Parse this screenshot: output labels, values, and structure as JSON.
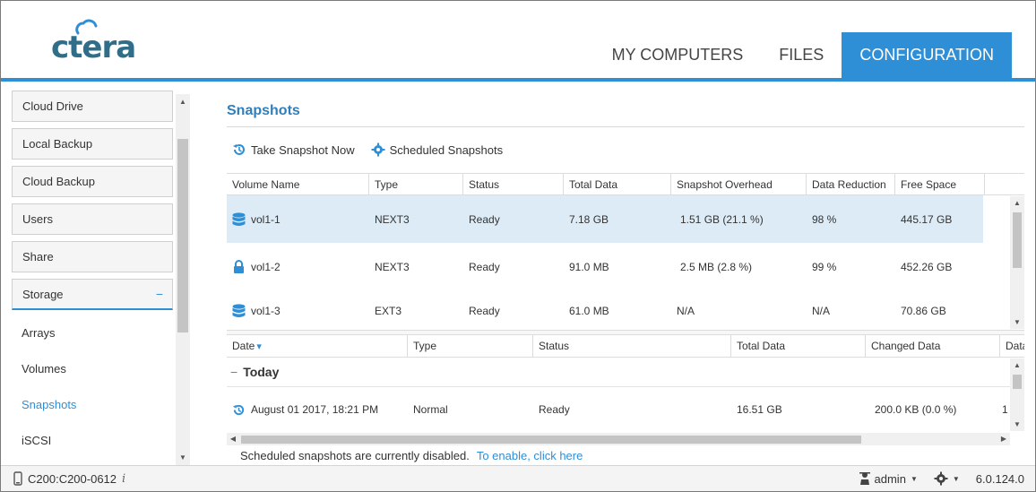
{
  "brand": {
    "logo_text": "ctera",
    "accent": "#2f8fd6",
    "title_color": "#2f7fbd",
    "selected_row": "#dcebf6"
  },
  "nav": {
    "tabs": [
      {
        "label": "MY COMPUTERS"
      },
      {
        "label": "FILES"
      },
      {
        "label": "CONFIGURATION",
        "active": true
      }
    ]
  },
  "sidebar": {
    "items": [
      {
        "label": "Cloud Drive"
      },
      {
        "label": "Local Backup"
      },
      {
        "label": "Cloud Backup"
      },
      {
        "label": "Users"
      },
      {
        "label": "Share"
      }
    ],
    "storage": {
      "label": "Storage",
      "toggle": "−"
    },
    "sub_items": [
      {
        "label": "Arrays"
      },
      {
        "label": "Volumes"
      },
      {
        "label": "Snapshots",
        "active": true
      },
      {
        "label": "iSCSI"
      }
    ]
  },
  "page": {
    "title": "Snapshots",
    "toolbar": {
      "take_snapshot": "Take Snapshot Now",
      "scheduled": "Scheduled Snapshots"
    }
  },
  "volumes_table": {
    "columns": [
      "Volume Name",
      "Type",
      "Status",
      "Total Data",
      "Snapshot Overhead",
      "Data Reduction",
      "Free Space"
    ],
    "rows": [
      {
        "icon": "database-icon",
        "name": "vol1-1",
        "type": "NEXT3",
        "status": "Ready",
        "total": "7.18 GB",
        "overhead": "1.51 GB  (21.1 %)",
        "reduction": "98 %",
        "free": "445.17 GB"
      },
      {
        "icon": "lock-icon",
        "name": "vol1-2",
        "type": "NEXT3",
        "status": "Ready",
        "total": "91.0 MB",
        "overhead": "2.5 MB  (2.8 %)",
        "reduction": "99 %",
        "free": "452.26 GB"
      },
      {
        "icon": "database-icon",
        "name": "vol1-3",
        "type": "EXT3",
        "status": "Ready",
        "total": "61.0 MB",
        "overhead": "N/A",
        "reduction": "N/A",
        "free": "70.86 GB"
      }
    ]
  },
  "snapshots_table": {
    "columns": [
      "Date",
      "Type",
      "Status",
      "Total Data",
      "Changed Data",
      "Data"
    ],
    "sort_indicator": "▾",
    "group": {
      "toggle": "−",
      "label": "Today"
    },
    "rows": [
      {
        "icon": "history-icon",
        "date": "August 01 2017, 18:21 PM",
        "type": "Normal",
        "status": "Ready",
        "total": "16.51 GB",
        "changed": "200.0 KB  (0.0 %)",
        "extra": "1"
      }
    ]
  },
  "notice": {
    "text": "Scheduled snapshots are currently disabled.",
    "link": "To enable, click here"
  },
  "footer": {
    "device": "C200:C200-0612",
    "info": "i",
    "user": "admin",
    "version": "6.0.124.0"
  }
}
